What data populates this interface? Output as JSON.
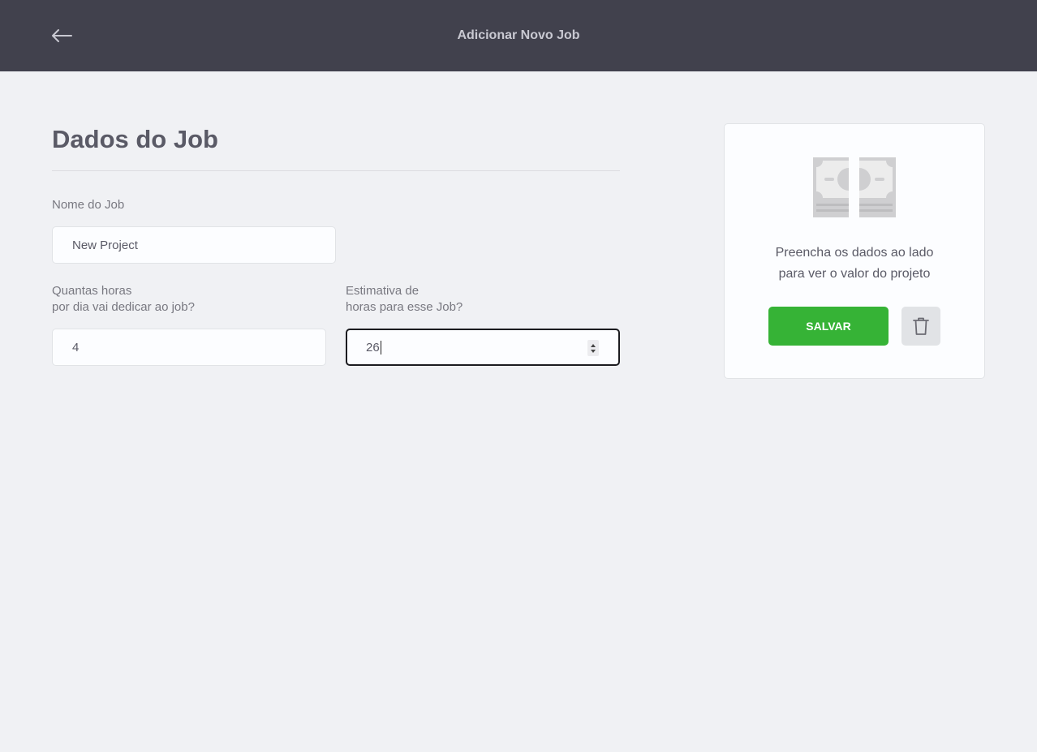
{
  "header": {
    "back_icon": "arrow-left-icon",
    "title": "Adicionar Novo Job"
  },
  "form": {
    "section_title": "Dados do Job",
    "job_name": {
      "label": "Nome do Job",
      "value": "New Project"
    },
    "daily_hours": {
      "label_line1": "Quantas horas",
      "label_line2": "por dia vai dedicar ao job?",
      "value": "4"
    },
    "total_hours": {
      "label_line1": "Estimativa de",
      "label_line2": "horas para esse Job?",
      "value": "26"
    }
  },
  "summary_card": {
    "icon": "money-icon",
    "text_line1": "Preencha os dados ao lado",
    "text_line2": "para ver o valor do projeto",
    "save_label": "SALVAR",
    "delete_icon": "trash-icon"
  },
  "colors": {
    "topbar": "#41414d",
    "background": "#f0f1f4",
    "save_button": "#36b336"
  }
}
